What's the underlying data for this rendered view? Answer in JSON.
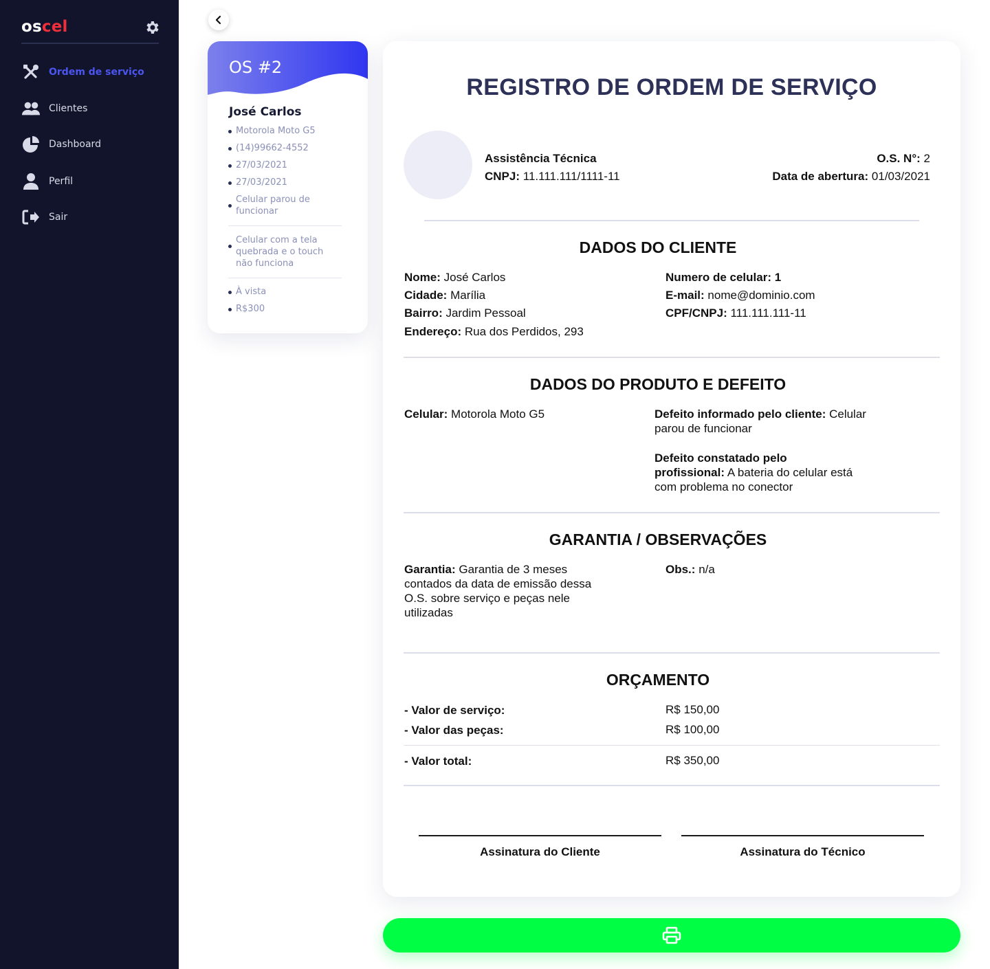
{
  "brand": {
    "name_part1": "os",
    "name_part2": "cel",
    "accent_color": "#ef2f3c"
  },
  "sidebar": {
    "items": [
      {
        "label": "Ordem de serviço",
        "icon": "tools-icon",
        "active": true
      },
      {
        "label": "Clientes",
        "icon": "users-icon",
        "active": false
      },
      {
        "label": "Dashboard",
        "icon": "pie-chart-icon",
        "active": false
      },
      {
        "label": "Perfil",
        "icon": "user-icon",
        "active": false
      },
      {
        "label": "Sair",
        "icon": "sign-out-icon",
        "active": false
      }
    ]
  },
  "os_card": {
    "title": "OS #2",
    "client_name": "José Carlos",
    "details": [
      "Motorola Moto G5",
      "(14)99662-4552",
      "27/03/2021",
      "27/03/2021",
      "Celular parou de funcionar"
    ],
    "defect_note": "Celular com a tela quebrada e o touch não funciona",
    "payment": [
      "À vista",
      "R$300"
    ]
  },
  "document": {
    "title": "REGISTRO DE ORDEM DE SERVIÇO",
    "company": {
      "name": "Assistência Técnica",
      "cnpj_label": "CNPJ:",
      "cnpj": "11.111.111/1111-11"
    },
    "os_number_label": "O.S. N°:",
    "os_number": "2",
    "opening_date_label": "Data de abertura:",
    "opening_date": "01/03/2021",
    "client_section": {
      "title": "DADOS DO CLIENTE",
      "nome_label": "Nome:",
      "nome": "José Carlos",
      "cidade_label": "Cidade:",
      "cidade": "Marília",
      "bairro_label": "Bairro:",
      "bairro": "Jardim Pessoal",
      "endereco_label": "Endereço:",
      "endereco": "Rua dos Perdidos, 293",
      "celular_label": "Numero de celular:",
      "celular": "1",
      "email_label": "E-mail:",
      "email": "nome@dominio.com",
      "cpf_label": "CPF/CNPJ:",
      "cpf": "111.111.111-11"
    },
    "product_section": {
      "title": "DADOS DO PRODUTO E DEFEITO",
      "celular_label": "Celular:",
      "celular": "Motorola Moto G5",
      "defeito_cliente_label": "Defeito informado pelo cliente:",
      "defeito_cliente": "Celular parou de funcionar",
      "defeito_prof_label": "Defeito constatado pelo profissional:",
      "defeito_prof": "A bateria do celular está com problema no conector"
    },
    "warranty_section": {
      "title": "GARANTIA / OBSERVAÇÕES",
      "garantia_label": "Garantia:",
      "garantia": "Garantia de 3 meses contados da data de emissão dessa O.S. sobre serviço e peças nele utilizadas",
      "obs_label": "Obs.:",
      "obs": "n/a"
    },
    "budget_section": {
      "title": "ORÇAMENTO",
      "servico_label": "- Valor de serviço:",
      "servico": "R$ 150,00",
      "pecas_label": "- Valor das peças:",
      "pecas": "R$ 100,00",
      "total_label": "- Valor total:",
      "total": "R$ 350,00"
    },
    "signatures": {
      "client": "Assinatura do Cliente",
      "technician": "Assinatura do Técnico"
    }
  },
  "print_button": {
    "icon": "printer-icon",
    "color": "#00ff44"
  }
}
